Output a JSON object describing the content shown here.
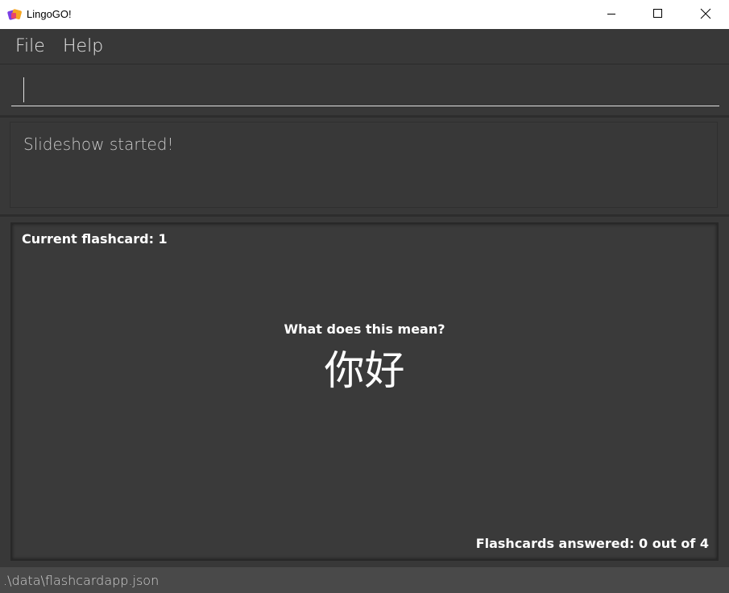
{
  "window": {
    "title": "LingoGO!",
    "controls": [
      "minimize-icon",
      "maximize-icon",
      "close-icon"
    ]
  },
  "menu": {
    "file_label": "File",
    "help_label": "Help"
  },
  "command": {
    "value": "",
    "placeholder": ""
  },
  "result": {
    "message": "Slideshow started!"
  },
  "flashcard": {
    "current_label": "Current flashcard: 1",
    "question": "What does this mean?",
    "word": "你好",
    "answered_label": "Flashcards answered: 0 out of 4"
  },
  "status": {
    "file_path": ".\\data\\flashcardapp.json"
  },
  "colors": {
    "background": "#383838",
    "titlebar": "#ffffff",
    "statusbar": "#494949",
    "text": "#ffffff"
  }
}
